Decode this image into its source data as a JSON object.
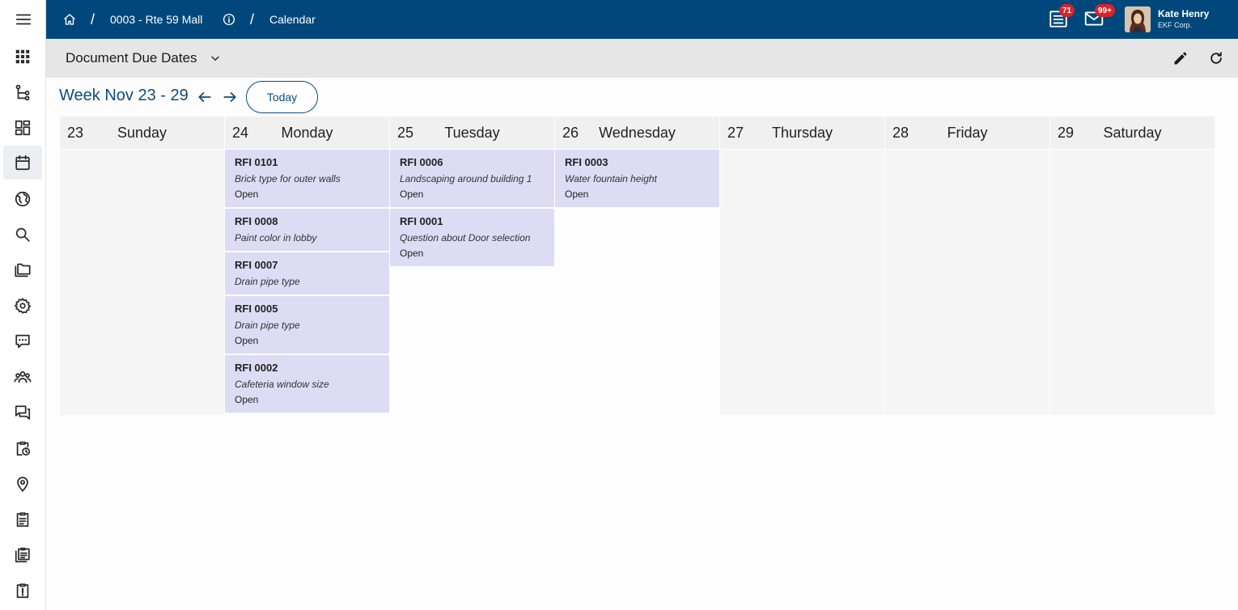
{
  "sidebar": {
    "menu_icon": "hamburger-icon",
    "items": [
      {
        "icon": "apps-grid-icon"
      },
      {
        "icon": "workflow-icon"
      },
      {
        "icon": "dashboard-icon"
      },
      {
        "icon": "calendar-icon",
        "active": true
      },
      {
        "icon": "globe-icon"
      },
      {
        "icon": "search-icon"
      },
      {
        "icon": "folders-icon"
      },
      {
        "icon": "gear-icon"
      },
      {
        "icon": "comment-icon"
      },
      {
        "icon": "people-icon"
      },
      {
        "icon": "chat-icon"
      },
      {
        "icon": "clipboard-clock-icon"
      },
      {
        "icon": "location-icon"
      },
      {
        "icon": "clipboard-list-icon"
      },
      {
        "icon": "documents-icon"
      },
      {
        "icon": "clipboard-alert-icon"
      }
    ]
  },
  "topbar": {
    "breadcrumb": {
      "project": "0003 - Rte 59 Mall",
      "page": "Calendar",
      "separator": "/"
    },
    "notifications_count": "71",
    "messages_count": "99+",
    "user": {
      "name": "Kate Henry",
      "company": "EKF Corp."
    },
    "brand_color": "#00487c"
  },
  "header": {
    "title": "Document Due Dates"
  },
  "week": {
    "title": "Week Nov 23 - 29",
    "today_label": "Today"
  },
  "days": [
    {
      "num": "23",
      "name": "Sunday",
      "events": []
    },
    {
      "num": "24",
      "name": "Monday",
      "events": [
        {
          "id": "RFI 0101",
          "desc": "Brick type for outer walls",
          "status": "Open"
        },
        {
          "id": "RFI 0008",
          "desc": "Paint color in lobby",
          "status": ""
        },
        {
          "id": "RFI 0007",
          "desc": "Drain pipe type",
          "status": ""
        },
        {
          "id": "RFI 0005",
          "desc": "Drain pipe type",
          "status": "Open"
        },
        {
          "id": "RFI 0002",
          "desc": "Cafeteria window size",
          "status": "Open"
        }
      ]
    },
    {
      "num": "25",
      "name": "Tuesday",
      "events": [
        {
          "id": "RFI 0006",
          "desc": "Landscaping around building 1",
          "status": "Open"
        },
        {
          "id": "RFI 0001",
          "desc": "Question about Door selection",
          "status": "Open"
        }
      ]
    },
    {
      "num": "26",
      "name": "Wednesday",
      "events": [
        {
          "id": "RFI 0003",
          "desc": "Water fountain height",
          "status": "Open"
        }
      ]
    },
    {
      "num": "27",
      "name": "Thursday",
      "events": []
    },
    {
      "num": "28",
      "name": "Friday",
      "events": []
    },
    {
      "num": "29",
      "name": "Saturday",
      "events": []
    }
  ],
  "colors": {
    "event_bg": "#dcdcf4",
    "accent": "#0d4c7d",
    "badge": "#d8232a"
  }
}
